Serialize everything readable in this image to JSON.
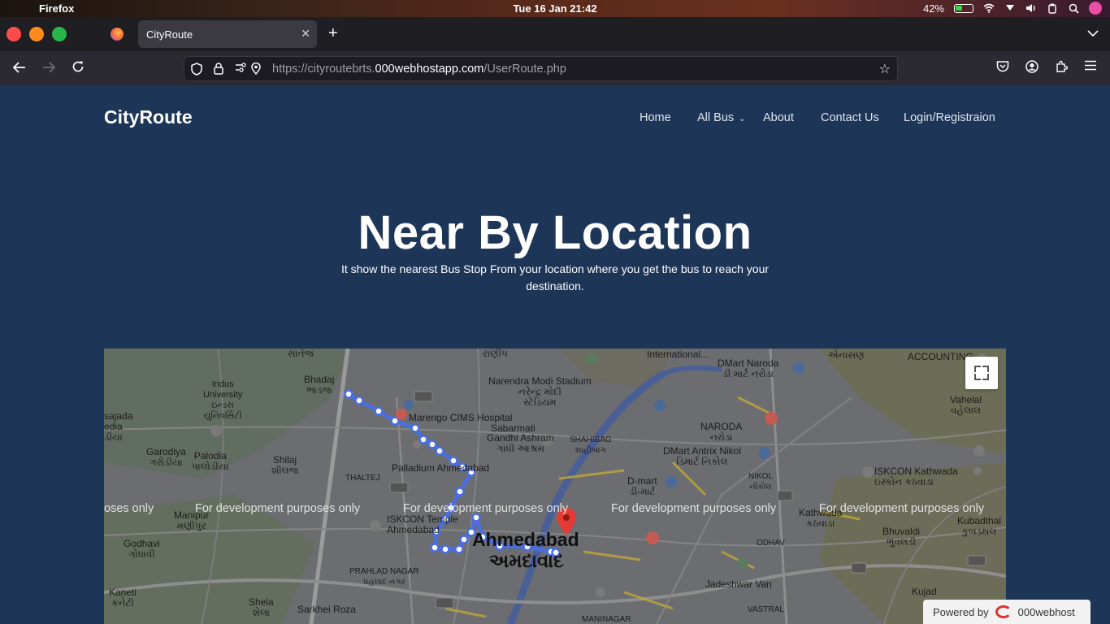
{
  "os": {
    "app_name": "Firefox",
    "clock": "Tue 16 Jan 21:42",
    "battery": "42%",
    "icons": [
      "apple-icon",
      "wifi-icon",
      "dropdown-icon",
      "volume-icon",
      "clipboard-icon",
      "search-icon"
    ]
  },
  "browser": {
    "tab_title": "CityRoute",
    "url_prefix": "https://cityroutebrts.",
    "url_domain": "000webhostapp.com",
    "url_suffix": "/UserRoute.php"
  },
  "site": {
    "brand": "CityRoute",
    "nav": {
      "home": "Home",
      "all_bus": "All Bus",
      "about": "About",
      "contact": "Contact Us",
      "login": "Login/Registraion"
    },
    "hero_title": "Near By Location",
    "hero_subtitle": "It show the nearest Bus Stop From your location where you get the bus to reach your destination."
  },
  "map": {
    "watermark": "For development purposes only",
    "watermark_partial": "oses only",
    "labels": {
      "bhadaj": "Bhadaj\nભાડજ",
      "indus": "Indus\nUniversity\nઇન્ડસ\nયુનિવર્સિટી",
      "sajada": "sajada\nedia\nડીયા",
      "garodiya": "Garodiya\nગરોડીયા",
      "palodia": "Palodia\nપાલોડીયા",
      "shilaj": "Shilaj\nશીલજ",
      "manipur": "Manipur\nમણીપુર",
      "godhavi": "Godhavi\nગોધાવી",
      "kaneti": "Kaneti\nકનેટી",
      "shela": "Shela\nશેલા",
      "sarkhej": "Sarkhei Roza",
      "prahlad": "PRAHLAD NAGAR\nપ્રહલાદ નગર",
      "marengo": "Marengo CIMS Hospital",
      "gandhi": "Gandhi Ashram\nગાંધી આશ્રમ",
      "sabarmati": "Sabarmati",
      "palladium": "Palladium Ahmedabad",
      "iskcon_temple": "ISKCON Temple\nAhmedabad",
      "stadium": "Narendra Modi Stadium\nનરેન્દ્ર મોદી\nસ્ટેડિયમ",
      "international": "International...",
      "dmart_naroda": "DMart Naroda\nડી માર્ટ નરોડા",
      "naroda": "NARODA\nનરોડા",
      "dmart_antrix": "DMart Antrix Nikol\nડિમાર્ટ નિકોલ",
      "nikol": "NIKOL\nનીકોલ",
      "shahibag": "SHAHIBAG\nશાહીબાગ",
      "dmart": "D-mart\nડી-માર્ટ",
      "ahmedabad": "Ahmedabad",
      "ahmedabad_guj": "અમદાવાદ",
      "iskcon_kathwada": "ISKCON Kathwada\nઇસ્કોન કઠવાડા",
      "kathwada": "Kathwada\nકઠવાડા",
      "vahelal": "Vahelal\nવહેલાલ",
      "bhuvaldi": "Bhuvaldi\nભુવલડી",
      "kubadthal": "Kubadthal\nકુબડથલ",
      "jadeshwar": "Jadeshwar Van",
      "kujad": "Kujad",
      "odhav": "ODHAV",
      "accounting": "ACCOUNTING",
      "maninagar": "MANINAGAR",
      "vastral": "VASTRAL",
      "thaltej": "THALTEJ",
      "satej": "સાતેજ",
      "ranip": "રાણીપ",
      "enasan": "એનાસણ"
    },
    "route_color": "#4a6ee0",
    "pin_color": "#e53935"
  },
  "footer": {
    "powered_by": "Powered by",
    "host": "000webhost"
  }
}
